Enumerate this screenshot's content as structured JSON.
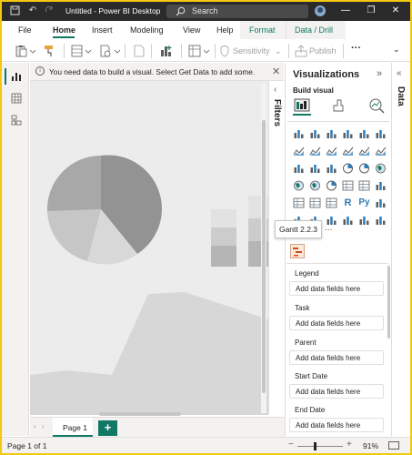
{
  "window": {
    "title": "Untitled - Power BI Desktop",
    "search_placeholder": "Search"
  },
  "menu": {
    "items": [
      "File",
      "Home",
      "Insert",
      "Modeling",
      "View",
      "Help",
      "Format",
      "Data / Drill"
    ],
    "active": "Home"
  },
  "ribbon": {
    "sensitivity_label": "Sensitivity",
    "publish_label": "Publish"
  },
  "infobar": {
    "message": "You need data to build a visual. Select Get Data to add some."
  },
  "filters": {
    "label": "Filters"
  },
  "visualizations": {
    "title": "Visualizations",
    "build_visual_label": "Build visual",
    "tooltip": "Gantt 2.2.3",
    "more": "...",
    "field_sections": [
      {
        "label": "Legend",
        "placeholder": "Add data fields here"
      },
      {
        "label": "Task",
        "placeholder": "Add data fields here"
      },
      {
        "label": "Parent",
        "placeholder": "Add data fields here"
      },
      {
        "label": "Start Date",
        "placeholder": "Add data fields here"
      },
      {
        "label": "End Date",
        "placeholder": "Add data fields here"
      }
    ],
    "icon_R": "R",
    "icon_Py": "Py"
  },
  "data_pane": {
    "label": "Data"
  },
  "pages": {
    "tab": "Page 1",
    "add": "+"
  },
  "status": {
    "page_indicator": "Page 1 of 1",
    "zoom": "91%",
    "zoom_minus": "−",
    "zoom_plus": "+"
  },
  "colors": {
    "accent": "#117865",
    "brand_border": "#f2c811",
    "titlebar": "#2b2b2b"
  }
}
